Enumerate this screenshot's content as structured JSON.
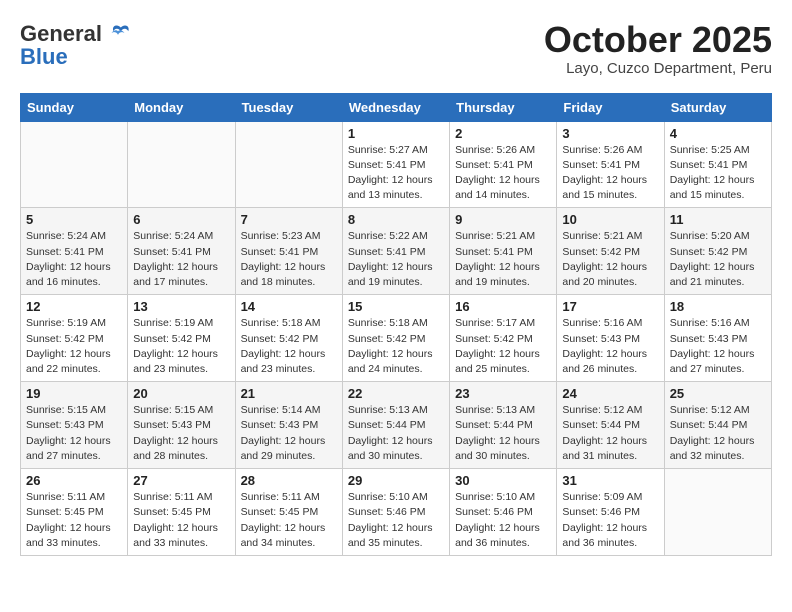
{
  "header": {
    "logo_line1": "General",
    "logo_line2": "Blue",
    "month": "October 2025",
    "location": "Layo, Cuzco Department, Peru"
  },
  "weekdays": [
    "Sunday",
    "Monday",
    "Tuesday",
    "Wednesday",
    "Thursday",
    "Friday",
    "Saturday"
  ],
  "weeks": [
    [
      {
        "day": "",
        "info": ""
      },
      {
        "day": "",
        "info": ""
      },
      {
        "day": "",
        "info": ""
      },
      {
        "day": "1",
        "info": "Sunrise: 5:27 AM\nSunset: 5:41 PM\nDaylight: 12 hours\nand 13 minutes."
      },
      {
        "day": "2",
        "info": "Sunrise: 5:26 AM\nSunset: 5:41 PM\nDaylight: 12 hours\nand 14 minutes."
      },
      {
        "day": "3",
        "info": "Sunrise: 5:26 AM\nSunset: 5:41 PM\nDaylight: 12 hours\nand 15 minutes."
      },
      {
        "day": "4",
        "info": "Sunrise: 5:25 AM\nSunset: 5:41 PM\nDaylight: 12 hours\nand 15 minutes."
      }
    ],
    [
      {
        "day": "5",
        "info": "Sunrise: 5:24 AM\nSunset: 5:41 PM\nDaylight: 12 hours\nand 16 minutes."
      },
      {
        "day": "6",
        "info": "Sunrise: 5:24 AM\nSunset: 5:41 PM\nDaylight: 12 hours\nand 17 minutes."
      },
      {
        "day": "7",
        "info": "Sunrise: 5:23 AM\nSunset: 5:41 PM\nDaylight: 12 hours\nand 18 minutes."
      },
      {
        "day": "8",
        "info": "Sunrise: 5:22 AM\nSunset: 5:41 PM\nDaylight: 12 hours\nand 19 minutes."
      },
      {
        "day": "9",
        "info": "Sunrise: 5:21 AM\nSunset: 5:41 PM\nDaylight: 12 hours\nand 19 minutes."
      },
      {
        "day": "10",
        "info": "Sunrise: 5:21 AM\nSunset: 5:42 PM\nDaylight: 12 hours\nand 20 minutes."
      },
      {
        "day": "11",
        "info": "Sunrise: 5:20 AM\nSunset: 5:42 PM\nDaylight: 12 hours\nand 21 minutes."
      }
    ],
    [
      {
        "day": "12",
        "info": "Sunrise: 5:19 AM\nSunset: 5:42 PM\nDaylight: 12 hours\nand 22 minutes."
      },
      {
        "day": "13",
        "info": "Sunrise: 5:19 AM\nSunset: 5:42 PM\nDaylight: 12 hours\nand 23 minutes."
      },
      {
        "day": "14",
        "info": "Sunrise: 5:18 AM\nSunset: 5:42 PM\nDaylight: 12 hours\nand 23 minutes."
      },
      {
        "day": "15",
        "info": "Sunrise: 5:18 AM\nSunset: 5:42 PM\nDaylight: 12 hours\nand 24 minutes."
      },
      {
        "day": "16",
        "info": "Sunrise: 5:17 AM\nSunset: 5:42 PM\nDaylight: 12 hours\nand 25 minutes."
      },
      {
        "day": "17",
        "info": "Sunrise: 5:16 AM\nSunset: 5:43 PM\nDaylight: 12 hours\nand 26 minutes."
      },
      {
        "day": "18",
        "info": "Sunrise: 5:16 AM\nSunset: 5:43 PM\nDaylight: 12 hours\nand 27 minutes."
      }
    ],
    [
      {
        "day": "19",
        "info": "Sunrise: 5:15 AM\nSunset: 5:43 PM\nDaylight: 12 hours\nand 27 minutes."
      },
      {
        "day": "20",
        "info": "Sunrise: 5:15 AM\nSunset: 5:43 PM\nDaylight: 12 hours\nand 28 minutes."
      },
      {
        "day": "21",
        "info": "Sunrise: 5:14 AM\nSunset: 5:43 PM\nDaylight: 12 hours\nand 29 minutes."
      },
      {
        "day": "22",
        "info": "Sunrise: 5:13 AM\nSunset: 5:44 PM\nDaylight: 12 hours\nand 30 minutes."
      },
      {
        "day": "23",
        "info": "Sunrise: 5:13 AM\nSunset: 5:44 PM\nDaylight: 12 hours\nand 30 minutes."
      },
      {
        "day": "24",
        "info": "Sunrise: 5:12 AM\nSunset: 5:44 PM\nDaylight: 12 hours\nand 31 minutes."
      },
      {
        "day": "25",
        "info": "Sunrise: 5:12 AM\nSunset: 5:44 PM\nDaylight: 12 hours\nand 32 minutes."
      }
    ],
    [
      {
        "day": "26",
        "info": "Sunrise: 5:11 AM\nSunset: 5:45 PM\nDaylight: 12 hours\nand 33 minutes."
      },
      {
        "day": "27",
        "info": "Sunrise: 5:11 AM\nSunset: 5:45 PM\nDaylight: 12 hours\nand 33 minutes."
      },
      {
        "day": "28",
        "info": "Sunrise: 5:11 AM\nSunset: 5:45 PM\nDaylight: 12 hours\nand 34 minutes."
      },
      {
        "day": "29",
        "info": "Sunrise: 5:10 AM\nSunset: 5:46 PM\nDaylight: 12 hours\nand 35 minutes."
      },
      {
        "day": "30",
        "info": "Sunrise: 5:10 AM\nSunset: 5:46 PM\nDaylight: 12 hours\nand 36 minutes."
      },
      {
        "day": "31",
        "info": "Sunrise: 5:09 AM\nSunset: 5:46 PM\nDaylight: 12 hours\nand 36 minutes."
      },
      {
        "day": "",
        "info": ""
      }
    ]
  ]
}
